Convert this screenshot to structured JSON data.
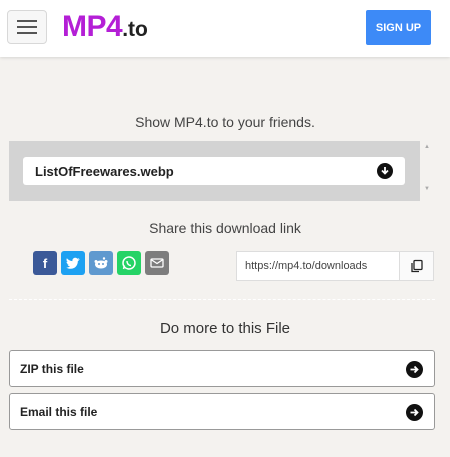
{
  "header": {
    "brand": "MP4",
    "tld": ".to",
    "signup_label": "SIGN UP"
  },
  "share_prompt": "Show MP4.to to your friends.",
  "file": {
    "selected": "ListOfFreewares.webp"
  },
  "share_link": {
    "title": "Share this download link",
    "url": "https://mp4.to/downloads"
  },
  "social": [
    "facebook-icon",
    "twitter-icon",
    "reddit-icon",
    "whatsapp-icon",
    "email-icon"
  ],
  "more": {
    "title": "Do more to this File",
    "actions": [
      {
        "label": "ZIP this file"
      },
      {
        "label": "Email this file"
      }
    ]
  },
  "colors": {
    "brand": "#b41fd6",
    "signup": "#3d8af7",
    "background": "#f4f2ef"
  }
}
